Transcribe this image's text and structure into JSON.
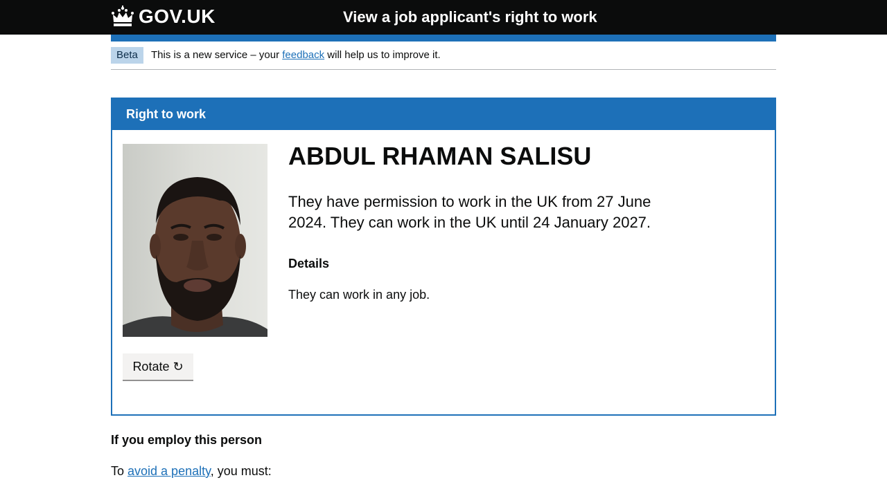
{
  "header": {
    "logo_text": "GOV.UK",
    "service_name": "View a job applicant's right to work"
  },
  "phase_banner": {
    "tag": "Beta",
    "text_before": "This is a new service – your ",
    "link_text": "feedback",
    "text_after": " will help us to improve it."
  },
  "card": {
    "title": "Right to work",
    "name": "ABDUL RHAMAN SALISU",
    "permission": "They have permission to work in the UK from 27 June 2024. They can work in the UK until 24 January 2027.",
    "details_heading": "Details",
    "details_text": "They can work in any job.",
    "rotate_label": "Rotate ↻"
  },
  "employ": {
    "heading": "If you employ this person",
    "text_before": "To ",
    "link_text": "avoid a penalty",
    "text_after": ", you must:"
  },
  "colors": {
    "header_bg": "#0b0c0c",
    "brand_blue": "#1d70b8",
    "tag_bg": "#bbd4ea",
    "link": "#1d70b8"
  },
  "icons": {
    "logo": "crown-icon",
    "rotate": "rotate-icon"
  }
}
